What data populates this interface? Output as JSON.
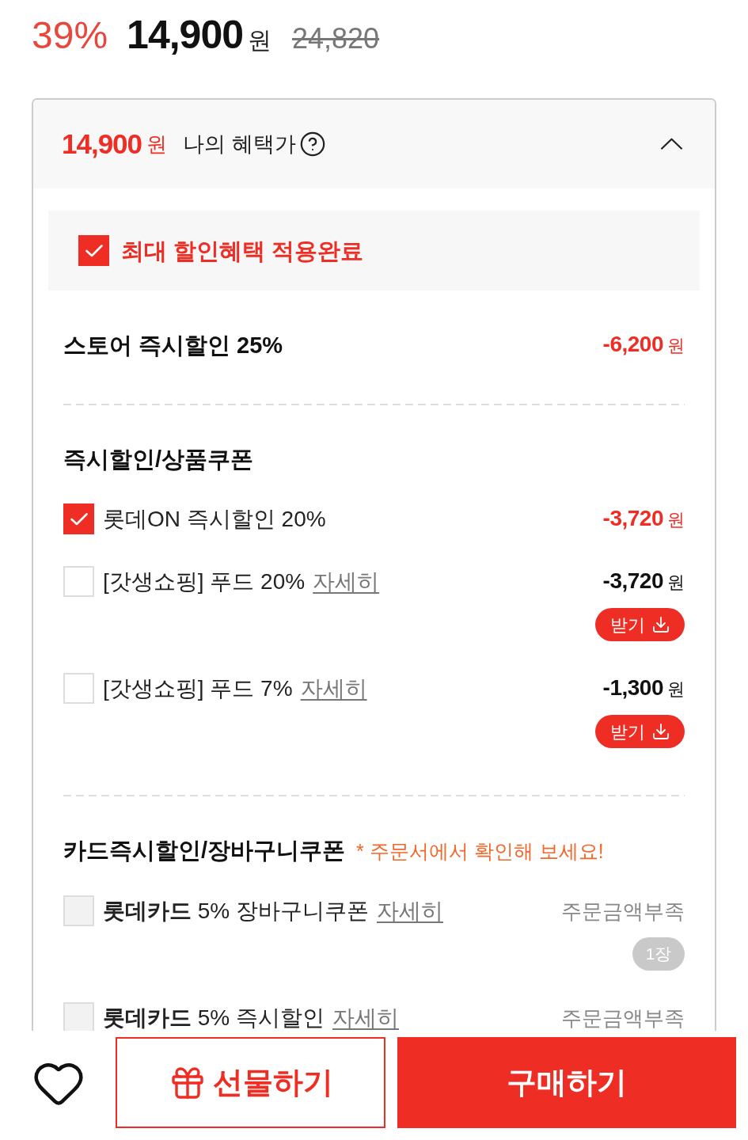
{
  "price_summary": {
    "discount_rate": "39%",
    "sale_price": "14,900",
    "currency": "원",
    "original_price": "24,820"
  },
  "benefit_panel": {
    "price": "14,900",
    "currency": "원",
    "label": "나의 혜택가",
    "expanded": true,
    "max_benefit": {
      "checked": true,
      "label": "최대 할인혜택 적용완료"
    },
    "store_discount": {
      "label": "스토어 즉시할인 25%",
      "amount": "-6,200",
      "currency": "원"
    },
    "sections": [
      {
        "title": "즉시할인/상품쿠폰",
        "coupons": [
          {
            "label": "롯데ON 즉시할인 20%",
            "checked": true,
            "disabled": false,
            "amount": "-3,720",
            "currency": "원"
          },
          {
            "label": "[갓생쇼핑] 푸드 20%",
            "link": "자세히",
            "checked": false,
            "disabled": false,
            "amount": "-3,720",
            "currency": "원",
            "action": {
              "kind": "button",
              "label": "받기"
            }
          },
          {
            "label": "[갓생쇼핑] 푸드 7%",
            "link": "자세히",
            "checked": false,
            "disabled": false,
            "amount": "-1,300",
            "currency": "원",
            "action": {
              "kind": "button",
              "label": "받기"
            }
          }
        ]
      },
      {
        "title": "카드즉시할인/장바구니쿠폰",
        "note": "* 주문서에서 확인해 보세요!",
        "coupons": [
          {
            "label": "**롯데카드** 5% 장바구니쿠폰",
            "link": "자세히",
            "checked": false,
            "disabled": true,
            "status": "주문금액부족",
            "action": {
              "kind": "badge",
              "label": "1장"
            }
          },
          {
            "label": "**롯데카드** 5% 즉시할인",
            "link": "자세히",
            "checked": false,
            "disabled": true,
            "status": "주문금액부족"
          }
        ]
      }
    ]
  },
  "bottom_bar": {
    "buttons": [
      {
        "kind": "gift",
        "label": "선물하기"
      },
      {
        "kind": "buy",
        "label": "구매하기"
      }
    ]
  }
}
